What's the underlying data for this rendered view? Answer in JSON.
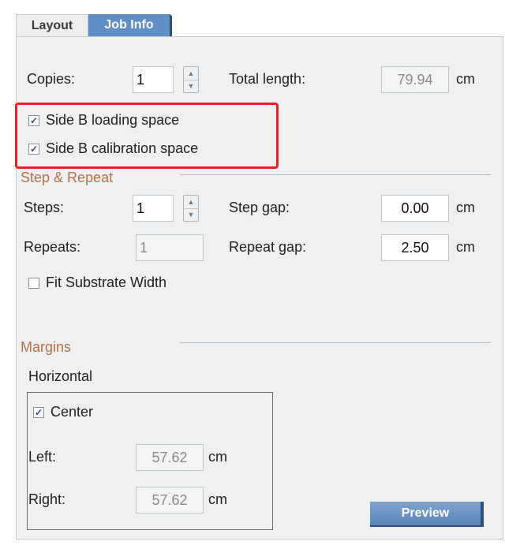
{
  "tabs": [
    {
      "label": "Layout"
    },
    {
      "label": "Job Info"
    }
  ],
  "copies": {
    "label": "Copies:",
    "value": "1"
  },
  "total_length": {
    "label": "Total length:",
    "value": "79.94",
    "unit": "cm"
  },
  "checkboxes": {
    "side_b_loading": {
      "label": "Side B loading space",
      "checked": true,
      "mark": "✓"
    },
    "side_b_calibration": {
      "label": "Side B calibration space",
      "checked": true,
      "mark": "✓"
    }
  },
  "step_repeat": {
    "title": "Step & Repeat",
    "steps": {
      "label": "Steps:",
      "value": "1"
    },
    "step_gap": {
      "label": "Step gap:",
      "value": "0.00",
      "unit": "cm"
    },
    "repeats": {
      "label": "Repeats:",
      "value": "1"
    },
    "repeat_gap": {
      "label": "Repeat gap:",
      "value": "2.50",
      "unit": "cm"
    },
    "fit_substrate": {
      "label": "Fit Substrate Width",
      "checked": false
    }
  },
  "margins": {
    "title": "Margins",
    "horizontal": "Horizontal",
    "center": {
      "label": "Center",
      "checked": true,
      "mark": "✓"
    },
    "left": {
      "label": "Left:",
      "value": "57.62",
      "unit": "cm"
    },
    "right": {
      "label": "Right:",
      "value": "57.62",
      "unit": "cm"
    }
  },
  "preview_button": "Preview",
  "colors": {
    "accent_tab": "#5f8fc4",
    "section_title": "#b5724a",
    "highlight": "#e8202a",
    "panel_bg": "#eef0f1"
  }
}
